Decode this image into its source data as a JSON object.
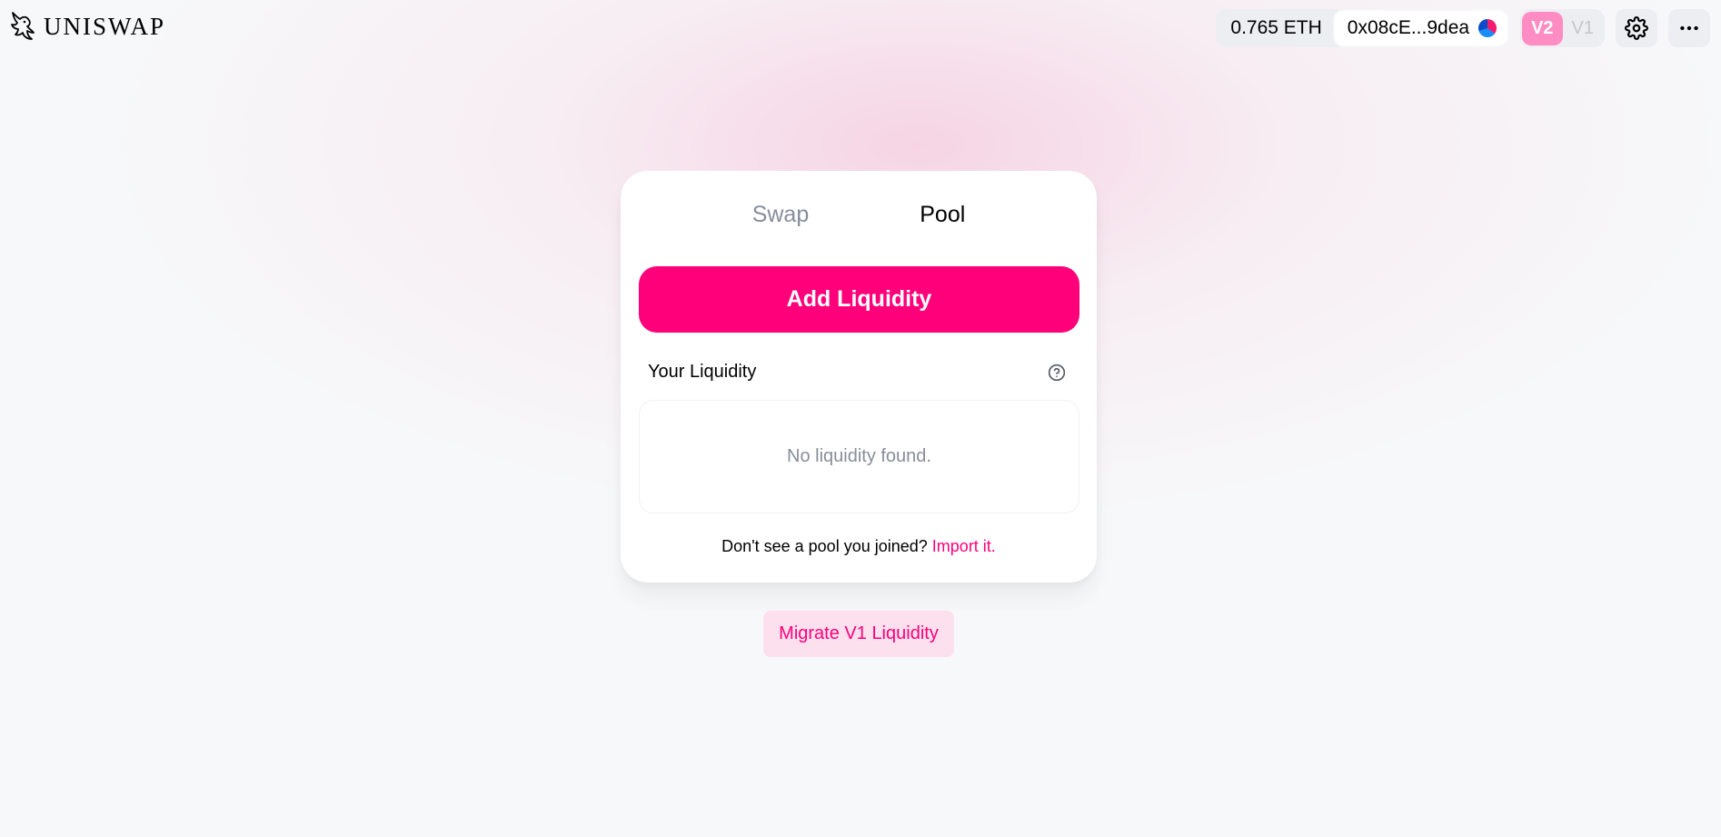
{
  "header": {
    "logo_text": "UNISWAP",
    "balance": "0.765 ETH",
    "address": "0x08cE...9dea",
    "versions": [
      {
        "label": "V2",
        "active": true
      },
      {
        "label": "V1",
        "active": false
      }
    ],
    "settings_icon": "gear-icon",
    "more_icon": "more-horizontal-icon"
  },
  "tabs": [
    {
      "label": "Swap",
      "active": false
    },
    {
      "label": "Pool",
      "active": true
    }
  ],
  "pool": {
    "add_liquidity_label": "Add Liquidity",
    "your_liquidity_label": "Your Liquidity",
    "help_icon": "question-icon",
    "empty_text": "No liquidity found.",
    "import_prompt": "Don't see a pool you joined?",
    "import_link": "Import it."
  },
  "migrate_label": "Migrate V1 Liquidity",
  "colors": {
    "accent": "#ff007a",
    "accent_light": "#fde0ee",
    "version_active": "#ff8cc3",
    "muted_text": "#888d9b"
  }
}
